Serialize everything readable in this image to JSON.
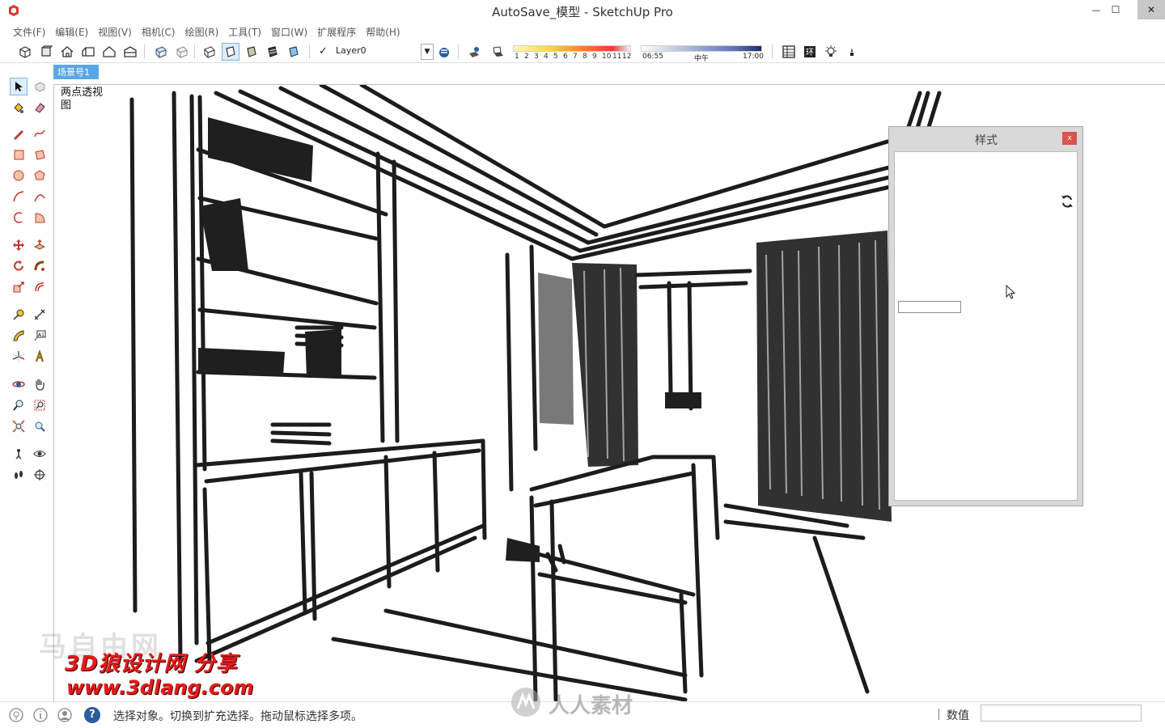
{
  "window": {
    "title": "AutoSave_模型 - SketchUp Pro",
    "minimize_glyph": "—",
    "maximize_glyph": "☐",
    "close_glyph": "✕"
  },
  "menu": [
    "文件(F)",
    "编辑(E)",
    "视图(V)",
    "相机(C)",
    "绘图(R)",
    "工具(T)",
    "窗口(W)",
    "扩展程序",
    "帮助(H)"
  ],
  "toolbar": {
    "layer_checkmark": "✓",
    "layer_name": "Layer0",
    "months": [
      "1",
      "2",
      "3",
      "4",
      "5",
      "6",
      "7",
      "8",
      "9",
      "10",
      "11",
      "12"
    ],
    "time_start": "06:55",
    "time_noon": "中午",
    "time_end": "17:00"
  },
  "scene": {
    "tab_label": "场景号1"
  },
  "viewport": {
    "perspective_label": "两点透视图"
  },
  "styles_panel": {
    "title": "样式",
    "close_label": "x",
    "refresh_glyph": "⟳"
  },
  "status": {
    "text": "选择对象。切换到扩充选择。拖动鼠标选择多项。",
    "measurement_label": "数值",
    "help_glyph": "?"
  },
  "watermarks": {
    "line1": "3D狼设计网 分享",
    "line2": "www.3dlang.com",
    "faded": "马自由网",
    "rrsc": "人人素材"
  },
  "colors": {
    "scene_tab": "#5aa7e6",
    "close_button": "#c7c7c7",
    "watermark_red": "#e61b1b",
    "sketch_stroke": "#1c1c1c"
  }
}
